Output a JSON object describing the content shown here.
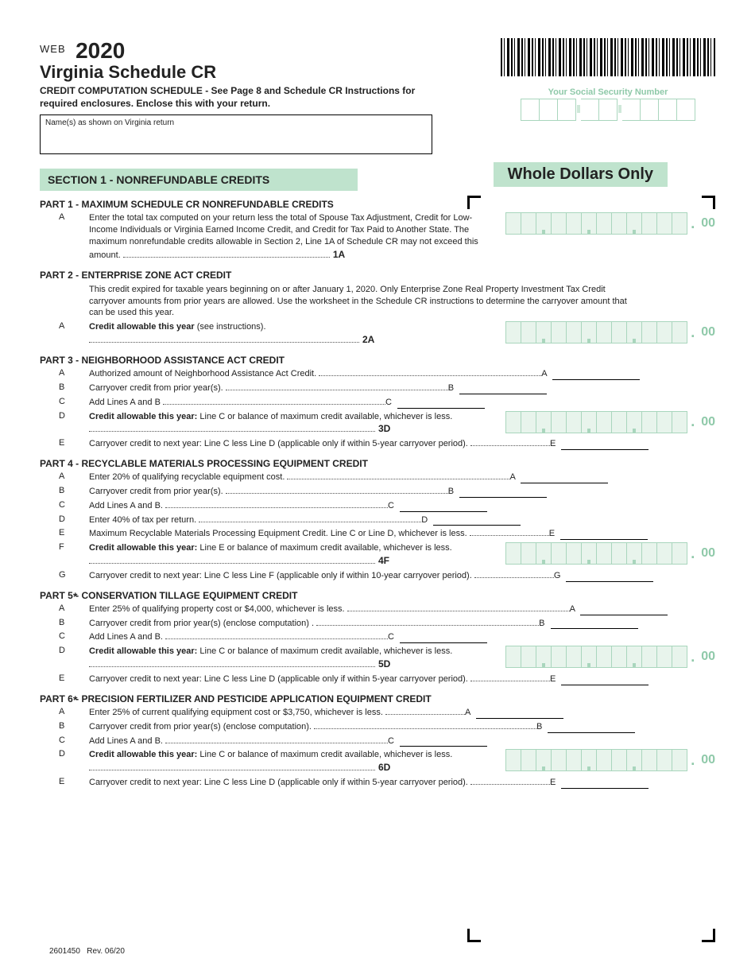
{
  "header": {
    "web": "WEB",
    "year": "2020",
    "title": "Virginia Schedule CR",
    "sub": "CREDIT COMPUTATION SCHEDULE - See Page 8 and Schedule CR Instructions for required enclosures. Enclose this with your return.",
    "names_label": "Name(s) as shown on Virginia return",
    "ssn_label": "Your Social Security Number",
    "wdo": "Whole Dollars Only"
  },
  "section1": {
    "title": "SECTION 1 - NONREFUNDABLE CREDITS"
  },
  "cents": "00",
  "part1": {
    "title": "PART 1 - MAXIMUM SCHEDULE CR NONREFUNDABLE CREDITS",
    "a_label": "A",
    "a_text": "Enter the total tax computed on your return less the total of Spouse Tax Adjustment, Credit for Low-Income Individuals or Virginia Earned Income Credit, and Credit for Tax Paid to Another State. The maximum nonrefundable credits allowable in  Section 2, Line 1A of Schedule CR may not exceed this amount. ",
    "a_tag": "1A"
  },
  "part2": {
    "title": "PART 2 - ENTERPRISE ZONE ACT CREDIT",
    "note": "This credit expired for taxable years beginning on or after January 1, 2020. Only Enterprise Zone Real Property Investment Tax Credit carryover amounts from prior years are allowed. Use the worksheet in the Schedule CR instructions to determine the carryover amount that can be used this year.",
    "a_label": "A",
    "a_bold": "Credit allowable this year",
    "a_rest": " (see instructions). ",
    "a_tag": "2A"
  },
  "part3": {
    "title": "PART 3 - NEIGHBORHOOD ASSISTANCE ACT CREDIT",
    "rows": [
      {
        "l": "A",
        "t": "Authorized amount of Neighborhood Assistance Act Credit. ",
        "end": "A"
      },
      {
        "l": "B",
        "t": "Carryover credit from prior year(s). ",
        "end": "B"
      },
      {
        "l": "C",
        "t": "Add Lines A and B  ",
        "end": "C"
      },
      {
        "l": "D",
        "bold": "Credit allowable this year:",
        "t": " Line C or balance of maximum credit available, whichever is less. ",
        "tag": "3D",
        "box": true
      },
      {
        "l": "E",
        "t": "Carryover credit to next year: Line C less Line D (applicable only if within 5-year carryover period). ",
        "end": "E"
      }
    ]
  },
  "part4": {
    "title": "PART 4 - RECYCLABLE MATERIALS PROCESSING EQUIPMENT CREDIT",
    "rows": [
      {
        "l": "A",
        "t": "Enter 20% of qualifying recyclable equipment cost. ",
        "end": "A"
      },
      {
        "l": "B",
        "t": "Carryover credit from prior year(s). ",
        "end": "B"
      },
      {
        "l": "C",
        "t": "Add Lines A and B. ",
        "end": "C"
      },
      {
        "l": "D",
        "t": "Enter 40% of tax per return. ",
        "end": "D"
      },
      {
        "l": "E",
        "t": "Maximum Recyclable Materials Processing Equipment Credit. Line C or Line D, whichever is less. ",
        "end": "E"
      },
      {
        "l": "F",
        "bold": "Credit allowable this year:",
        "t": " Line E or balance of maximum credit available, whichever is less. ",
        "tag": "4F",
        "box": true
      },
      {
        "l": "G",
        "t": "Carryover credit to next year: Line C less Line F (applicable only if within 10-year carryover period). ",
        "end": "G"
      }
    ]
  },
  "part5": {
    "title": "PART 5 - CONSERVATION TILLAGE EQUIPMENT CREDIT",
    "star": "*",
    "rows": [
      {
        "l": "A",
        "t": "Enter 25% of qualifying property cost or $4,000, whichever is less. ",
        "end": "A"
      },
      {
        "l": "B",
        "t": "Carryover credit from prior year(s) (enclose computation) . ",
        "end": "B"
      },
      {
        "l": "C",
        "t": "Add Lines A and B. ",
        "end": "C"
      },
      {
        "l": "D",
        "bold": "Credit allowable this year:",
        "t": " Line C or balance of maximum credit available, whichever is less. ",
        "tag": "5D",
        "box": true
      },
      {
        "l": "E",
        "t": "Carryover credit to next year: Line C less Line D (applicable only if within 5-year carryover period). ",
        "end": "E"
      }
    ]
  },
  "part6": {
    "title": "PART 6 - PRECISION FERTILIZER AND PESTICIDE APPLICATION EQUIPMENT CREDIT",
    "star": "*",
    "rows": [
      {
        "l": "A",
        "t": "Enter 25% of current qualifying equipment cost or $3,750, whichever is less. ",
        "end": "A"
      },
      {
        "l": "B",
        "t": "Carryover credit from prior year(s) (enclose computation). ",
        "end": "B"
      },
      {
        "l": "C",
        "t": "Add Lines A and B. ",
        "end": "C"
      },
      {
        "l": "D",
        "bold": "Credit allowable this year:",
        "t": " Line C or balance of maximum credit available, whichever is less. ",
        "tag": "6D",
        "box": true
      },
      {
        "l": "E",
        "t": "Carryover credit to next year: Line C less Line D (applicable only if within 5-year carryover period). ",
        "end": "E"
      }
    ]
  },
  "footer": {
    "form_no": "2601450",
    "rev": "Rev. 06/20"
  }
}
